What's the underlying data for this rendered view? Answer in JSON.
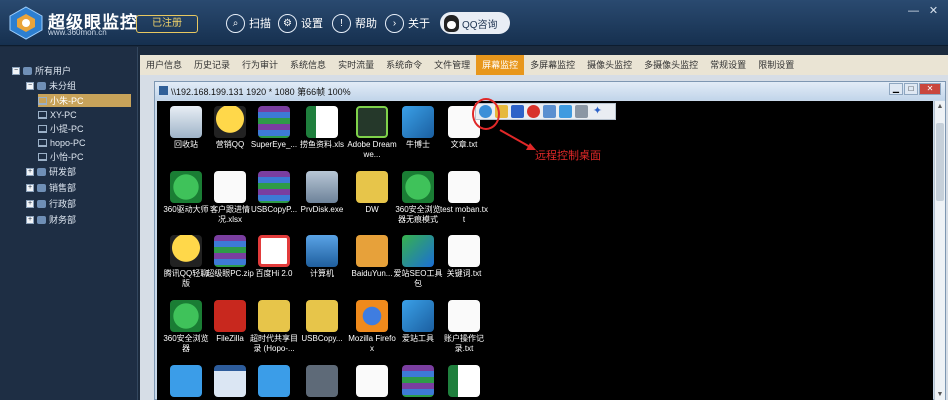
{
  "header": {
    "brand": "超级眼监控",
    "url": "www.360mon.cn",
    "registered": "已注册",
    "nav": [
      {
        "label": "扫描",
        "icon": "search-icon"
      },
      {
        "label": "设置",
        "icon": "gear-icon"
      },
      {
        "label": "帮助",
        "icon": "help-icon"
      },
      {
        "label": "关于",
        "icon": "info-arrow-icon"
      }
    ],
    "qq": "QQ咨询"
  },
  "sidebar": {
    "root": "所有用户",
    "group_unassigned": "未分组",
    "pcs": [
      "小朱-PC",
      "XY-PC",
      "小提-PC",
      "hopo-PC",
      "小怡-PC"
    ],
    "departments": [
      "研发部",
      "销售部",
      "行政部",
      "财务部"
    ]
  },
  "tabs": [
    "用户信息",
    "历史记录",
    "行为审计",
    "系统信息",
    "实时流量",
    "系统命令",
    "文件管理",
    "屏幕监控",
    "多屏幕监控",
    "摄像头监控",
    "多摄像头监控",
    "常规设置",
    "限制设置"
  ],
  "active_tab": "屏幕监控",
  "remote_window": {
    "title": "\\\\192.168.199.131 1920 * 1080 第66帧 100%",
    "icons": [
      [
        "回收站",
        "营销QQ",
        "SuperEye_...",
        "捞鱼资料.xls",
        "Adobe Dreamwe...",
        "牛博士",
        "文章.txt"
      ],
      [
        "360驱动大师",
        "客户跟进情况.xlsx",
        "USBCopyP...",
        "PrvDisk.exe",
        "DW",
        "360安全浏览器无痕模式",
        "test moban.txt"
      ],
      [
        "腾讯QQ轻聊版",
        "超级眼PC.zip",
        "百度Hi 2.0",
        "计算机",
        "BaiduYun...",
        "爱站SEO工具包",
        "关键词.txt"
      ],
      [
        "360安全浏览器",
        "FileZilla",
        "超时代共享目录 (Hopo-...",
        "USBCopy...",
        "Mozilla Firefox",
        "爱站工具",
        "账户操作记录.txt"
      ]
    ]
  },
  "annotation": "远程控制桌面"
}
